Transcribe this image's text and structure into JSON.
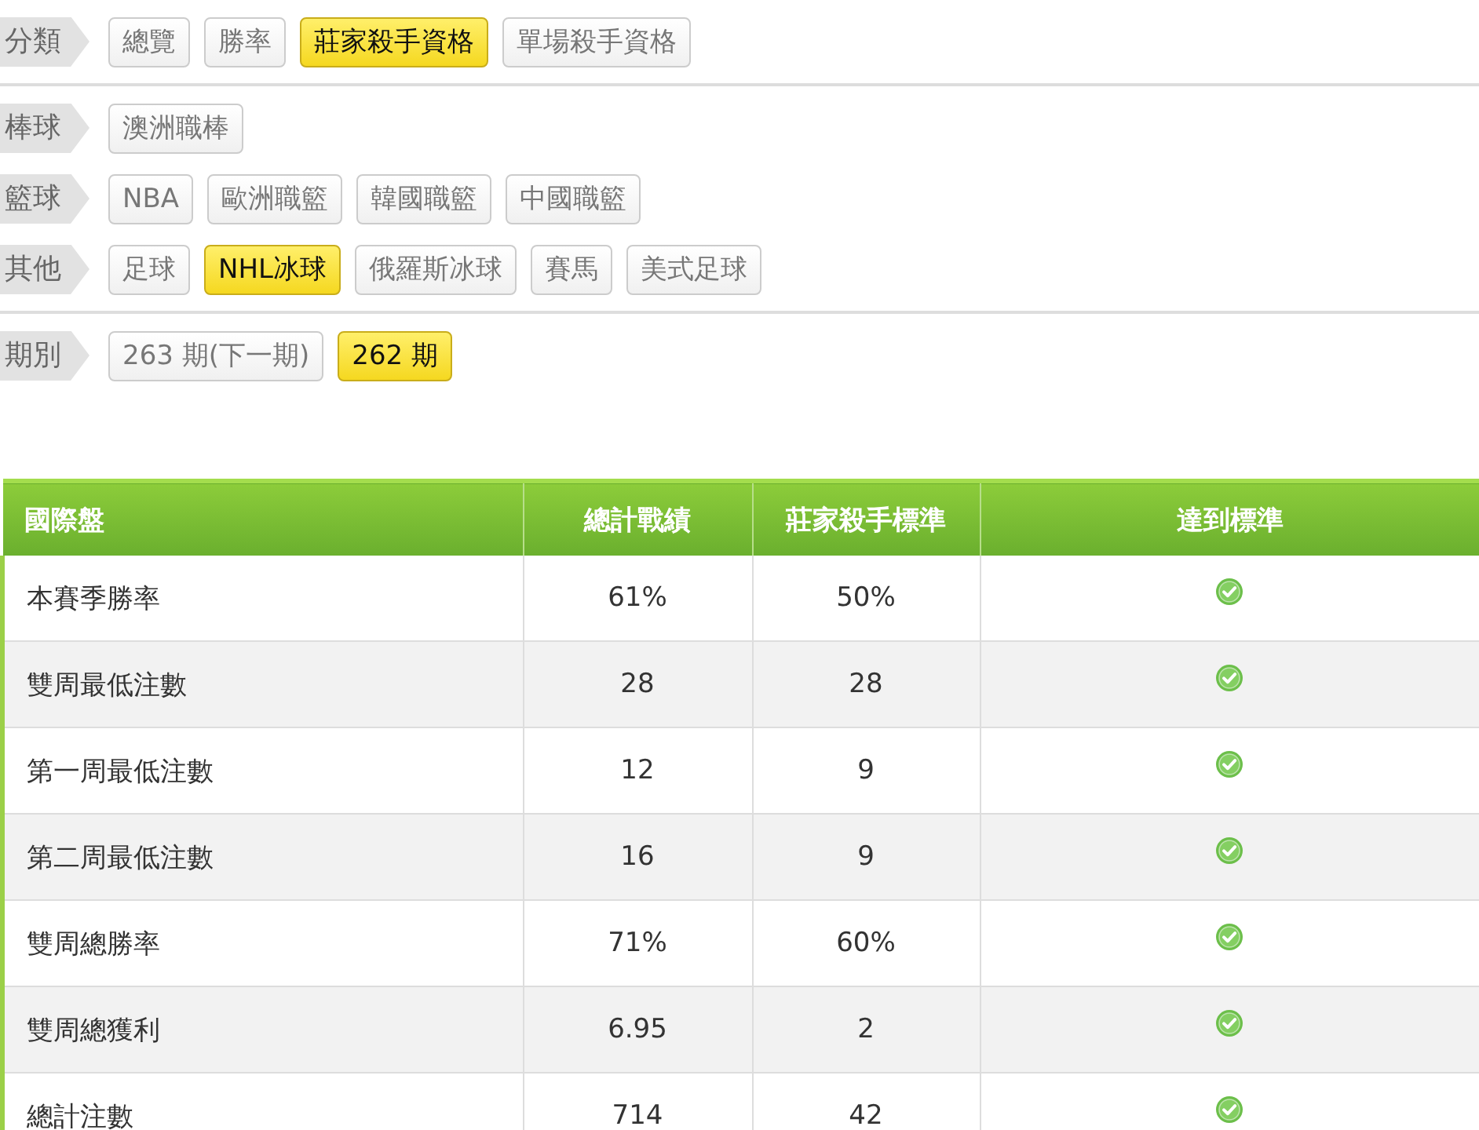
{
  "filter_sections": [
    [
      {
        "label": "分類",
        "options": [
          {
            "label": "總覽",
            "selected": false
          },
          {
            "label": "勝率",
            "selected": false
          },
          {
            "label": "莊家殺手資格",
            "selected": true
          },
          {
            "label": "單場殺手資格",
            "selected": false
          }
        ]
      }
    ],
    [
      {
        "label": "棒球",
        "options": [
          {
            "label": "澳洲職棒",
            "selected": false
          }
        ]
      },
      {
        "label": "籃球",
        "options": [
          {
            "label": "NBA",
            "selected": false
          },
          {
            "label": "歐洲職籃",
            "selected": false
          },
          {
            "label": "韓國職籃",
            "selected": false
          },
          {
            "label": "中國職籃",
            "selected": false
          }
        ]
      },
      {
        "label": "其他",
        "options": [
          {
            "label": "足球",
            "selected": false
          },
          {
            "label": "NHL冰球",
            "selected": true
          },
          {
            "label": "俄羅斯冰球",
            "selected": false
          },
          {
            "label": "賽馬",
            "selected": false
          },
          {
            "label": "美式足球",
            "selected": false
          }
        ]
      }
    ],
    [
      {
        "label": "期別",
        "options": [
          {
            "label": "263 期(下一期)",
            "selected": false
          },
          {
            "label": "262 期",
            "selected": true
          }
        ]
      }
    ]
  ],
  "table": {
    "columns": [
      "國際盤",
      "總計戰績",
      "莊家殺手標準",
      "達到標準"
    ],
    "rows": [
      {
        "item": "本賽季勝率",
        "record": "61%",
        "standard": "50%",
        "met": true
      },
      {
        "item": "雙周最低注數",
        "record": "28",
        "standard": "28",
        "met": true
      },
      {
        "item": "第一周最低注數",
        "record": "12",
        "standard": "9",
        "met": true
      },
      {
        "item": "第二周最低注數",
        "record": "16",
        "standard": "9",
        "met": true
      },
      {
        "item": "雙周總勝率",
        "record": "71%",
        "standard": "60%",
        "met": true
      },
      {
        "item": "雙周總獲利",
        "record": "6.95",
        "standard": "2",
        "met": true
      },
      {
        "item": "總計注數",
        "record": "714",
        "standard": "42",
        "met": true
      }
    ]
  }
}
